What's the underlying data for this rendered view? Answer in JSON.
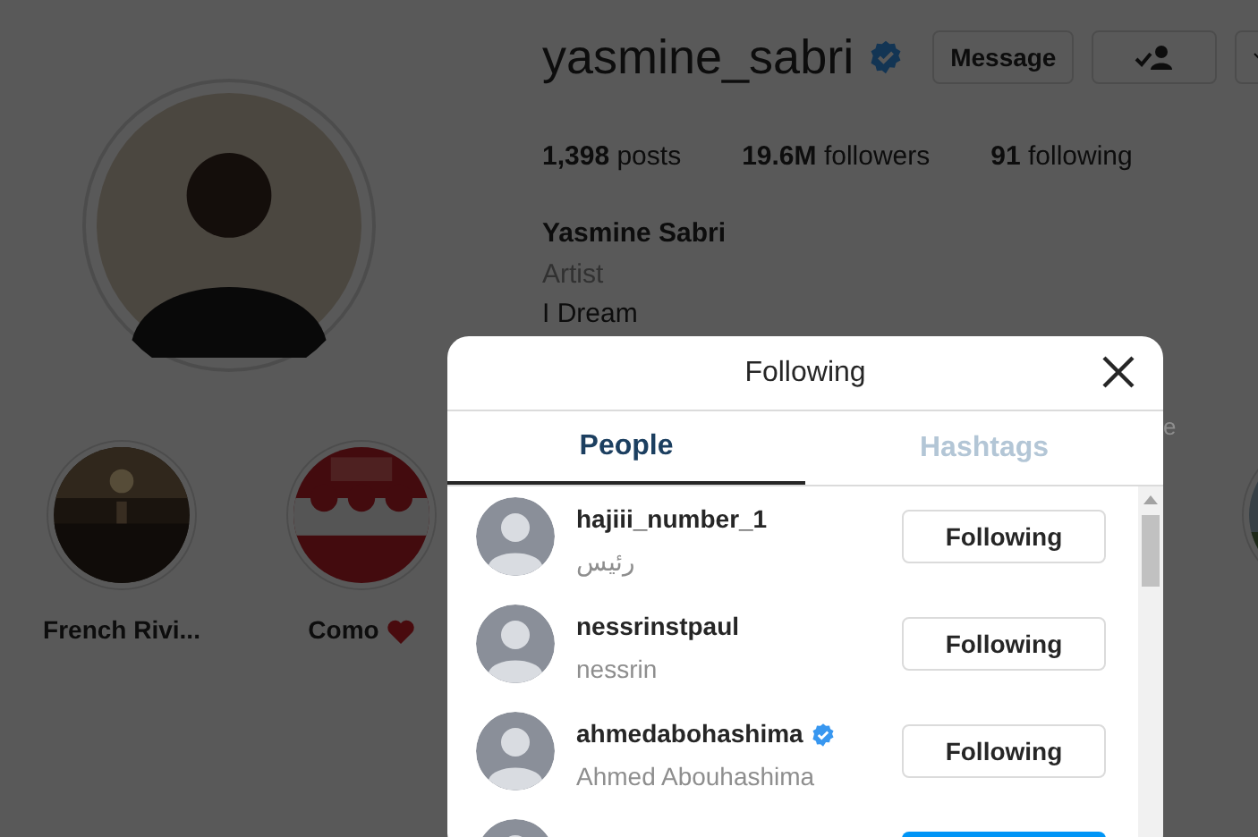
{
  "profile": {
    "username": "yasmine_sabri",
    "verified": true,
    "message_button": "Message",
    "stats": [
      {
        "value": "1,398",
        "label": "posts"
      },
      {
        "value": "19.6M",
        "label": "followers"
      },
      {
        "value": "91",
        "label": "following"
      }
    ],
    "full_name": "Yasmine Sabri",
    "category": "Artist",
    "bio": "I Dream",
    "fragment": "e"
  },
  "highlights": [
    {
      "label": "French Rivi...",
      "heart": false,
      "kind": "sunset"
    },
    {
      "label": "Como",
      "heart": true,
      "kind": "striped"
    },
    {
      "kind": "palm"
    }
  ],
  "modal": {
    "title": "Following",
    "tabs": [
      {
        "label": "People",
        "selected": true
      },
      {
        "label": "Hashtags",
        "selected": false
      }
    ],
    "users": [
      {
        "username": "hajiii_number_1",
        "name": "رئيس",
        "verified": false,
        "following": true,
        "button": "Following"
      },
      {
        "username": "nessrinstpaul",
        "name": "nessrin",
        "verified": false,
        "following": true,
        "button": "Following"
      },
      {
        "username": "ahmedabohashima",
        "name": "Ahmed Abouhashima",
        "verified": true,
        "following": true,
        "button": "Following"
      },
      {
        "following": false
      }
    ]
  }
}
